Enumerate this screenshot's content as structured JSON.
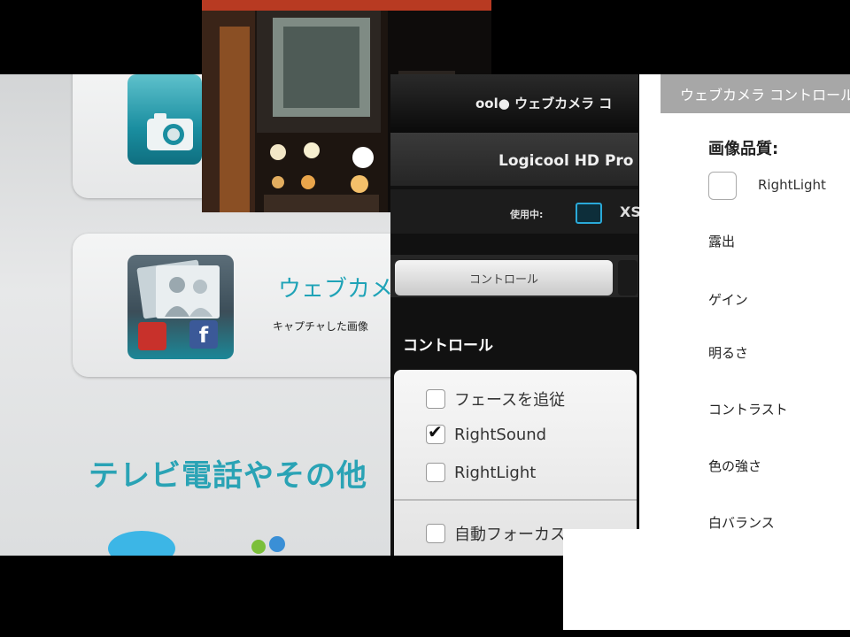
{
  "back_window": {
    "share_title": "ウェブカメ",
    "share_subtitle": "キャプチャした画像",
    "videocall_heading": "テレビ電話やその他"
  },
  "control_panel": {
    "brand": "ool● ウェブカメラ コ",
    "device_name": "Logicool HD Pro",
    "status_label": "使用中:",
    "status_value": "XS",
    "tab_control": "コントロール",
    "section_title": "コントロール",
    "options": [
      {
        "label": "フェースを追従",
        "checked": false
      },
      {
        "label": "RightSound",
        "checked": true
      },
      {
        "label": "RightLight",
        "checked": false
      },
      {
        "label": "自動フォーカス",
        "checked": false
      }
    ]
  },
  "right_panel": {
    "title": "ウェブカメラ コントロール",
    "image_quality_label": "画像品質:",
    "rightlight_label": "RightLight",
    "settings": [
      "露出",
      "ゲイン",
      "明るさ",
      "コントラスト",
      "色の強さ",
      "白バランス"
    ]
  },
  "colors": {
    "accent_teal": "#1fa3b7",
    "panel_dark": "#111111",
    "title_gray": "#a7a7a7"
  }
}
